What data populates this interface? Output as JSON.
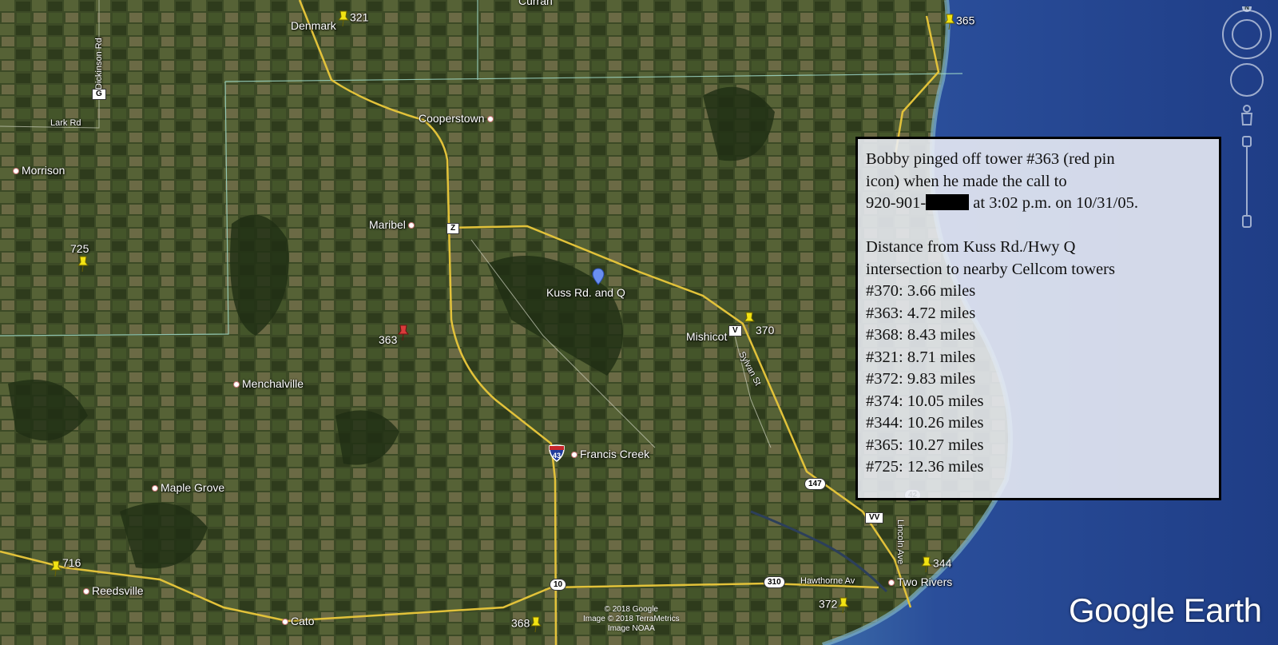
{
  "places": [
    {
      "label": "Denmark"
    },
    {
      "label": "Curran"
    },
    {
      "label": "Cooperstown"
    },
    {
      "label": "Morrison"
    },
    {
      "label": "Maribel"
    },
    {
      "label": "Kuss Rd. and Q"
    },
    {
      "label": "Mishicot"
    },
    {
      "label": "Menchalville"
    },
    {
      "label": "Francis Creek"
    },
    {
      "label": "Maple Grove"
    },
    {
      "label": "Reedsville"
    },
    {
      "label": "Cato"
    },
    {
      "label": "Two Rivers"
    }
  ],
  "towers": [
    {
      "label": "321",
      "color": "yellow"
    },
    {
      "label": "365",
      "color": "yellow"
    },
    {
      "label": "725",
      "color": "yellow"
    },
    {
      "label": "363",
      "color": "red"
    },
    {
      "label": "370",
      "color": "yellow"
    },
    {
      "label": "716",
      "color": "yellow"
    },
    {
      "label": "344",
      "color": "yellow"
    },
    {
      "label": "372",
      "color": "yellow"
    },
    {
      "label": "368",
      "color": "yellow"
    }
  ],
  "roads": {
    "G": "G",
    "lark": "Lark Rd",
    "dickinson": "Dickinson Rd",
    "Z": "Z",
    "V": "V",
    "sylvan": "Sylvan St",
    "r147": "147",
    "r42": "42",
    "VV": "VV",
    "r310": "310",
    "r10": "10",
    "hawthorne": "Hawthorne Av",
    "i43": "43",
    "lincoln": "Lincoln Ave"
  },
  "info": {
    "line1": "Bobby pinged off tower #363 (red pin",
    "line2": "icon) when he made the call to",
    "line3a": "920-901-",
    "line3b": " at 3:02 p.m. on 10/31/05.",
    "heading1": "Distance from Kuss Rd./Hwy Q",
    "heading2": "intersection to nearby Cellcom towers",
    "distances": [
      "#370: 3.66 miles",
      "#363: 4.72 miles",
      "#368: 8.43 miles",
      "#321: 8.71 miles",
      "#372: 9.83 miles",
      "#374: 10.05 miles",
      "#344: 10.26 miles",
      "#365: 10.27 miles",
      "#725: 12.36 miles"
    ]
  },
  "copyright": {
    "line1": "© 2018 Google",
    "line2": "Image © 2018 TerraMetrics",
    "line3": "Image NOAA"
  },
  "branding": "Google Earth",
  "compass": "N",
  "colors": {
    "road": "#e2c23a",
    "border": "#9fd9c8",
    "water": "#2a4e9a",
    "redPin": "#d93b3b",
    "yellowPin": "#f2e313"
  }
}
